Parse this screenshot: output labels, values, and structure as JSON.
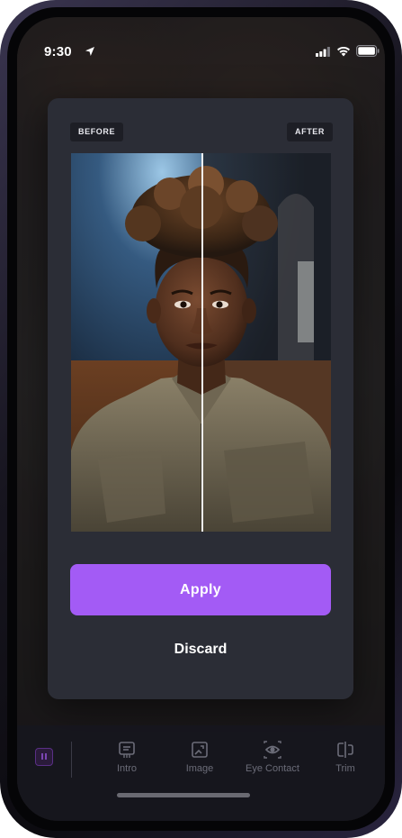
{
  "status_bar": {
    "time": "9:30"
  },
  "compare_labels": {
    "before": "BEFORE",
    "after": "AFTER"
  },
  "actions": {
    "apply": "Apply",
    "discard": "Discard"
  },
  "toolbar": {
    "tools": [
      {
        "label": "Intro",
        "icon": "intro-icon"
      },
      {
        "label": "Image",
        "icon": "image-icon"
      },
      {
        "label": "Eye Contact",
        "icon": "eye-contact-icon"
      },
      {
        "label": "Trim",
        "icon": "trim-icon"
      }
    ]
  },
  "colors": {
    "accent": "#a35bf5",
    "card_background": "#2b2d36",
    "tag_background": "#1d1e25",
    "toolbar_text": "#6b6c78"
  }
}
